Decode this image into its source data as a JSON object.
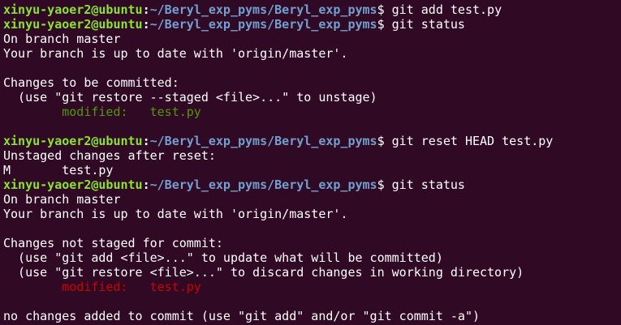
{
  "prompt": {
    "user_host": "xinyu-yaoer2@ubuntu",
    "separator": ":",
    "path": "~/Beryl_exp_pyms/Beryl_exp_pyms",
    "symbol": "$ "
  },
  "lines": [
    {
      "kind": "prompt",
      "cmd": "git add test.py"
    },
    {
      "kind": "prompt",
      "cmd": "git status"
    },
    {
      "kind": "out",
      "text": "On branch master"
    },
    {
      "kind": "out",
      "text": "Your branch is up to date with 'origin/master'."
    },
    {
      "kind": "blank"
    },
    {
      "kind": "out",
      "text": "Changes to be committed:"
    },
    {
      "kind": "out",
      "text": "  (use \"git restore --staged <file>...\" to unstage)"
    },
    {
      "kind": "staged",
      "text": "        modified:   test.py"
    },
    {
      "kind": "blank"
    },
    {
      "kind": "prompt",
      "cmd": "git reset HEAD test.py"
    },
    {
      "kind": "out",
      "text": "Unstaged changes after reset:"
    },
    {
      "kind": "out",
      "text": "M       test.py"
    },
    {
      "kind": "prompt",
      "cmd": "git status"
    },
    {
      "kind": "out",
      "text": "On branch master"
    },
    {
      "kind": "out",
      "text": "Your branch is up to date with 'origin/master'."
    },
    {
      "kind": "blank"
    },
    {
      "kind": "out",
      "text": "Changes not staged for commit:"
    },
    {
      "kind": "out",
      "text": "  (use \"git add <file>...\" to update what will be committed)"
    },
    {
      "kind": "out",
      "text": "  (use \"git restore <file>...\" to discard changes in working directory)"
    },
    {
      "kind": "unstaged",
      "text": "        modified:   test.py"
    },
    {
      "kind": "blank"
    },
    {
      "kind": "out",
      "text": "no changes added to commit (use \"git add\" and/or \"git commit -a\")"
    }
  ],
  "colors": {
    "background": "#300a24",
    "user_host": "#8ae234",
    "path": "#729fcf",
    "staged": "#4e9a06",
    "unstaged": "#cc0000",
    "text": "#ffffff"
  }
}
